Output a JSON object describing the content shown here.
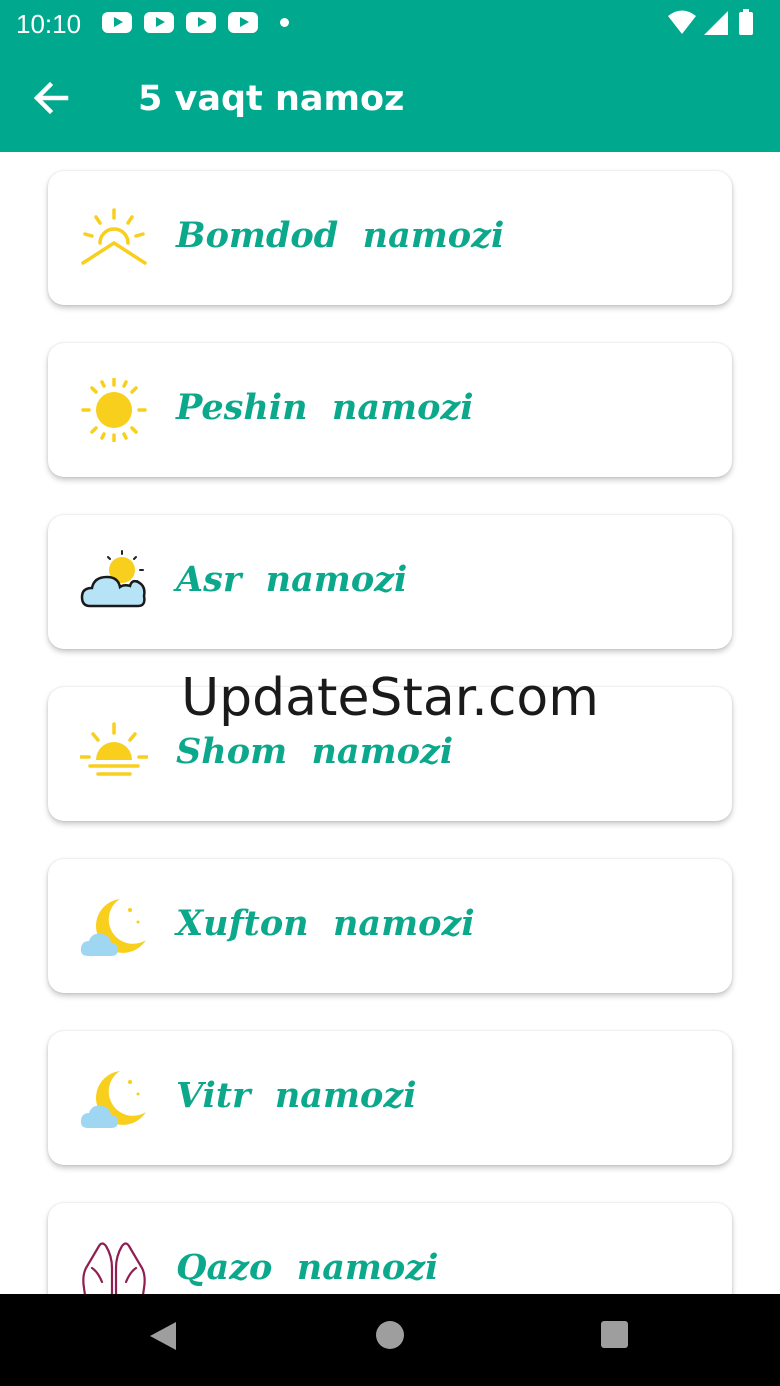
{
  "status_bar": {
    "time": "10:10",
    "notification_icons": [
      "youtube-icon",
      "youtube-icon",
      "youtube-icon",
      "youtube-icon",
      "dot-icon"
    ],
    "system_icons": [
      "wifi-icon",
      "signal-icon",
      "battery-icon"
    ]
  },
  "app_bar": {
    "title": "5 vaqt namoz",
    "back_icon": "arrow-left-icon"
  },
  "colors": {
    "primary": "#00a88e",
    "label": "#0ca88b",
    "sun": "#f7cf1c",
    "cloud": "#b7e3f7",
    "hands": "#8f1e52"
  },
  "prayers": [
    {
      "label": "Bomdod  namozi",
      "icon": "sunrise-icon"
    },
    {
      "label": "Peshin  namozi",
      "icon": "sun-icon"
    },
    {
      "label": "Asr  namozi",
      "icon": "sun-cloud-icon"
    },
    {
      "label": "Shom  namozi",
      "icon": "sunset-icon"
    },
    {
      "label": "Xufton  namozi",
      "icon": "moon-cloud-icon"
    },
    {
      "label": "Vitr  namozi",
      "icon": "moon-cloud-icon"
    },
    {
      "label": "Qazo  namozi",
      "icon": "praying-hands-icon"
    }
  ],
  "watermark": "UpdateStar.com",
  "nav_bar": {
    "buttons": [
      "back-icon",
      "home-icon",
      "recents-icon"
    ]
  }
}
